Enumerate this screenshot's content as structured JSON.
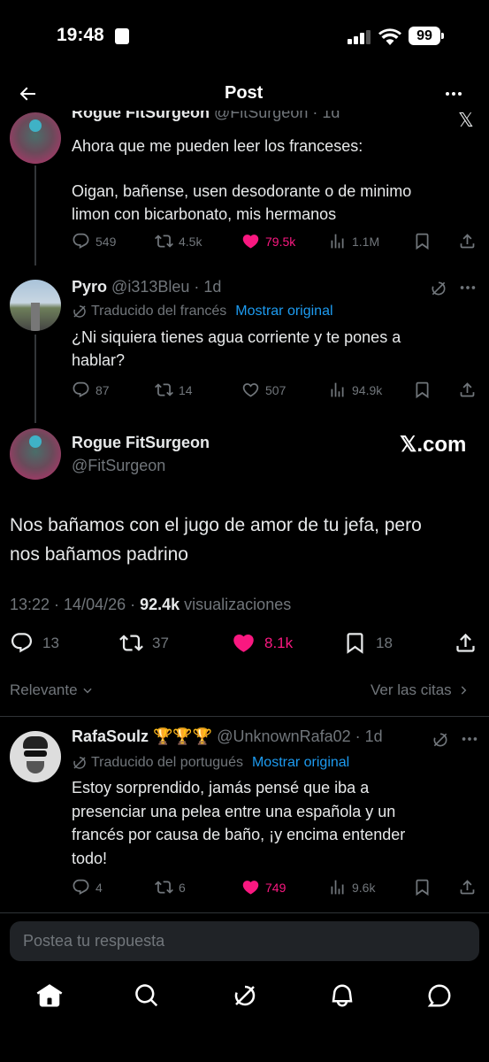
{
  "status_bar": {
    "time": "19:48",
    "battery": "99"
  },
  "header": {
    "title": "Post"
  },
  "tweet1": {
    "name": "Rogue FitSurgeon",
    "handle": "@FitSurgeon · 1d",
    "line1": "Ahora que me pueden leer los franceses:",
    "line2": "Oigan, bañense, usen desodorante o de minimo",
    "line3": "limon con bicarbonato, mis hermanos",
    "replies": "549",
    "reposts": "4.5k",
    "likes": "79.5k",
    "views": "1.1M"
  },
  "tweet2": {
    "name": "Pyro",
    "handle": "@i313Bleu · 1d",
    "translated": "Traducido del francés",
    "show_original": "Mostrar original",
    "line1": "¿Ni siquiera tienes agua corriente y te pones a",
    "line2": "hablar?",
    "replies": "87",
    "reposts": "14",
    "likes": "507",
    "views": "94.9k"
  },
  "main": {
    "name": "Rogue FitSurgeon",
    "handle": "@FitSurgeon",
    "watermark": "𝕏.com",
    "line1": "Nos bañamos con el jugo de amor de tu jefa, pero",
    "line2": "nos bañamos padrino",
    "timestamp": "13:22 · 14/04/26 · ",
    "views_count": "92.4k",
    "views_label": " visualizaciones",
    "replies": "13",
    "reposts": "37",
    "likes": "8.1k",
    "bookmarks": "18"
  },
  "filter": {
    "relevant": "Relevante",
    "quotes": "Ver las citas"
  },
  "reply": {
    "name": "RafaSoulz 🏆🏆🏆",
    "handle": "@UnknownRafa02 · 1d",
    "translated": "Traducido del portugués",
    "show_original": "Mostrar original",
    "line1": "Estoy sorprendido, jamás pensé que iba a",
    "line2": "presenciar una pelea entre una española y un",
    "line3": "francés por causa de baño, ¡y encima entender",
    "line4": "todo!",
    "replies": "4",
    "reposts": "6",
    "likes": "749",
    "views": "9.6k"
  },
  "composer": {
    "placeholder": "Postea tu respuesta"
  },
  "colors": {
    "like": "#f91880",
    "link": "#1d9bf0",
    "muted": "#71767b"
  }
}
